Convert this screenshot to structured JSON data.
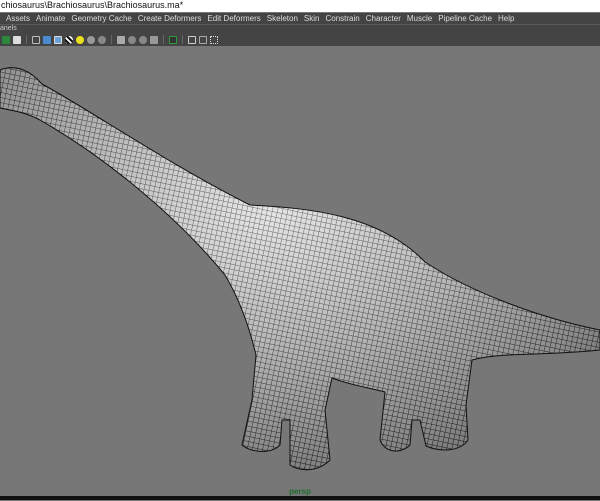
{
  "title": "chiosaurus\\Brachiosaurus\\Brachiosaurus.ma*",
  "menu": [
    "Assets",
    "Animate",
    "Geometry Cache",
    "Create Deformers",
    "Edit Deformers",
    "Skeleton",
    "Skin",
    "Constrain",
    "Character",
    "Muscle",
    "Pipeline Cache",
    "Help"
  ],
  "panels_label": "anels",
  "toolbar_icons": [
    "two-pane-icon",
    "wireframe-icon",
    "smooth-shade-icon",
    "wireframe-on-shaded-icon",
    "textured-icon",
    "light-icon",
    "shadow-icon",
    "sphere-icon",
    "ambient-occlusion-icon",
    "motion-blur-icon",
    "antialias-icon",
    "multisample-icon",
    "isolate-select-icon",
    "xray-icon",
    "xray-joints-icon",
    "xray-components-icon"
  ],
  "viewport": {
    "camera": "persp"
  }
}
